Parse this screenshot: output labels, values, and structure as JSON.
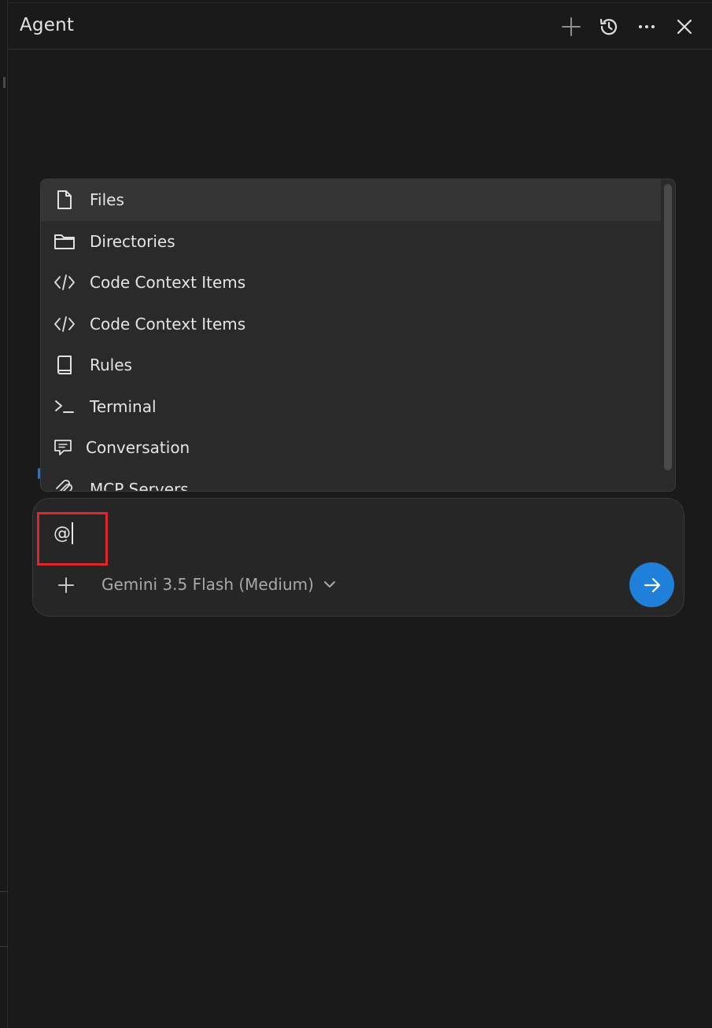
{
  "header": {
    "title": "Agent",
    "actions": [
      {
        "name": "new-chat",
        "icon": "plus-icon"
      },
      {
        "name": "history",
        "icon": "history-icon"
      },
      {
        "name": "more",
        "icon": "ellipsis-icon"
      },
      {
        "name": "close",
        "icon": "close-icon"
      }
    ]
  },
  "mention_menu": {
    "items": [
      {
        "label": "Files",
        "icon": "file-icon",
        "active": true
      },
      {
        "label": "Directories",
        "icon": "folder-icon"
      },
      {
        "label": "Code Context Items",
        "icon": "code-icon"
      },
      {
        "label": "Code Context Items",
        "icon": "code-icon"
      },
      {
        "label": "Rules",
        "icon": "book-icon"
      },
      {
        "label": "Terminal",
        "icon": "terminal-icon"
      },
      {
        "label": "Conversation",
        "icon": "chat-icon"
      },
      {
        "label": "MCP Servers",
        "icon": "mcp-icon"
      }
    ]
  },
  "composer": {
    "value": "@",
    "model": "Gemini 3.5 Flash (Medium)"
  },
  "colors": {
    "background": "#1a1a1a",
    "menu_bg": "#2a2a2a",
    "send_button": "#1f7fd9",
    "highlight": "#e1262b"
  }
}
